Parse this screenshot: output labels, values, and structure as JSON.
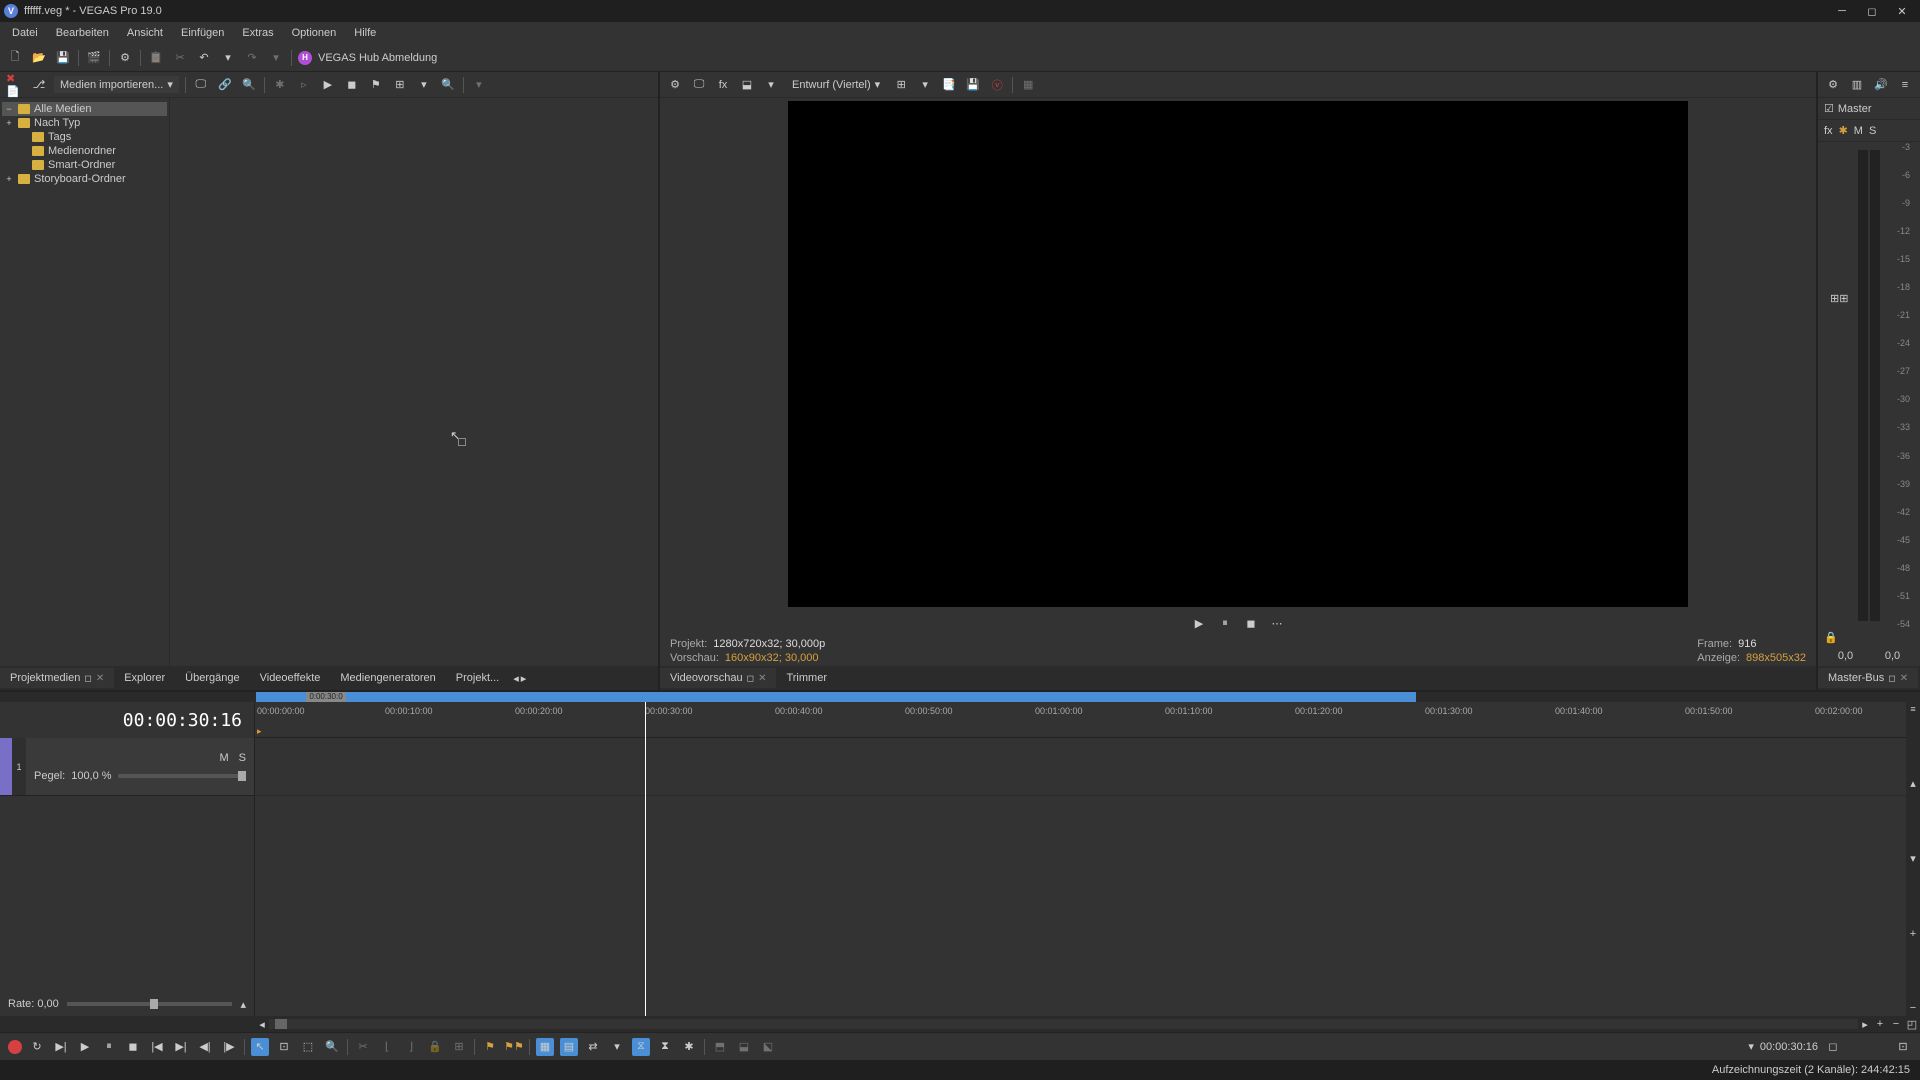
{
  "window": {
    "title": "ffffff.veg * - VEGAS Pro 19.0",
    "icon_letter": "V"
  },
  "menu": [
    "Datei",
    "Bearbeiten",
    "Ansicht",
    "Einfügen",
    "Extras",
    "Optionen",
    "Hilfe"
  ],
  "hub": {
    "icon_letter": "H",
    "label": "VEGAS Hub Abmeldung"
  },
  "left": {
    "import_label": "Medien importieren...",
    "tree": [
      {
        "label": "Alle Medien",
        "selected": true,
        "expand": "−",
        "child": false
      },
      {
        "label": "Nach Typ",
        "selected": false,
        "expand": "+",
        "child": false
      },
      {
        "label": "Tags",
        "selected": false,
        "expand": "",
        "child": true
      },
      {
        "label": "Medienordner",
        "selected": false,
        "expand": "",
        "child": true
      },
      {
        "label": "Smart-Ordner",
        "selected": false,
        "expand": "",
        "child": true
      },
      {
        "label": "Storyboard-Ordner",
        "selected": false,
        "expand": "+",
        "child": false
      }
    ],
    "tabs": [
      "Projektmedien",
      "Explorer",
      "Übergänge",
      "Videoeffekte",
      "Mediengeneratoren",
      "Projekt..."
    ],
    "active_tab": 0
  },
  "preview": {
    "draft_label": "Entwurf (Viertel)",
    "status": {
      "projekt_lbl": "Projekt:",
      "projekt_val": "1280x720x32; 30,000p",
      "vorschau_lbl": "Vorschau:",
      "vorschau_val": "160x90x32; 30,000",
      "frame_lbl": "Frame:",
      "frame_val": "916",
      "anzeige_lbl": "Anzeige:",
      "anzeige_val": "898x505x32"
    },
    "tabs": [
      "Videovorschau",
      "Trimmer"
    ],
    "active_tab": 0
  },
  "master": {
    "label": "Master",
    "ctrls": [
      "fx",
      "✱",
      "M",
      "S"
    ],
    "scale": [
      "-3",
      "-6",
      "-9",
      "-12",
      "-15",
      "-18",
      "-21",
      "-24",
      "-27",
      "-30",
      "-33",
      "-36",
      "-39",
      "-42",
      "-45",
      "-48",
      "-51",
      "-54"
    ],
    "foot": [
      "0,0",
      "0,0"
    ],
    "tab": "Master-Bus",
    "widget": "⊞⊞"
  },
  "timeline": {
    "timecode": "00:00:30:16",
    "loop_marker": "0:00:30:0",
    "ruler": [
      "00:00:00:00",
      "00:00:10:00",
      "00:00:20:00",
      "00:00:30:00",
      "00:00:40:00",
      "00:00:50:00",
      "00:01:00:00",
      "00:01:10:00",
      "00:01:20:00",
      "00:01:30:00",
      "00:01:40:00",
      "00:01:50:00",
      "00:02:00:00"
    ],
    "track": {
      "num": "1",
      "m": "M",
      "s": "S",
      "pegel_lbl": "Pegel:",
      "pegel_val": "100,0 %"
    },
    "rate": "Rate: 0,00",
    "rmark": "▸"
  },
  "transport": {
    "timecode": "00:00:30:16"
  },
  "statusbar": "Aufzeichnungszeit (2 Kanäle): 244:42:15"
}
